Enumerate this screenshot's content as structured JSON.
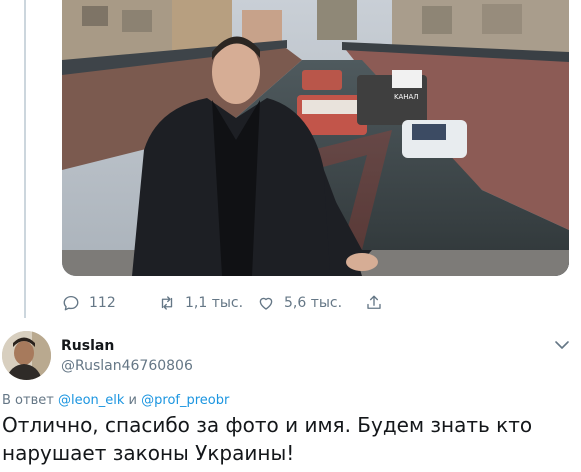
{
  "prev_tweet": {
    "media": {
      "subject": "photo",
      "boat_sign": "KAHAЛ"
    },
    "actions": {
      "reply_icon": "comment-icon",
      "reply_count": "112",
      "retweet_icon": "retweet-icon",
      "retweet_count": "1,1 тыс.",
      "like_icon": "heart-icon",
      "like_count": "5,6 тыс.",
      "share_icon": "share-icon"
    }
  },
  "reply_tweet": {
    "author": {
      "name": "Ruslan",
      "handle": "@Ruslan46760806"
    },
    "menu_icon": "chevron-down-icon",
    "reply_to": {
      "prefix": "В ответ",
      "mention_1": "@leon_elk",
      "conjunction": "и",
      "mention_2": "@prof_preobr"
    },
    "text": "Отлично, спасибо за фото и имя. Будем знать кто нарушает законы Украины!"
  },
  "colors": {
    "link": "#1b95e0",
    "secondary_text": "#657786",
    "primary_text": "#14171a",
    "thread_line": "#ccd6dd"
  }
}
